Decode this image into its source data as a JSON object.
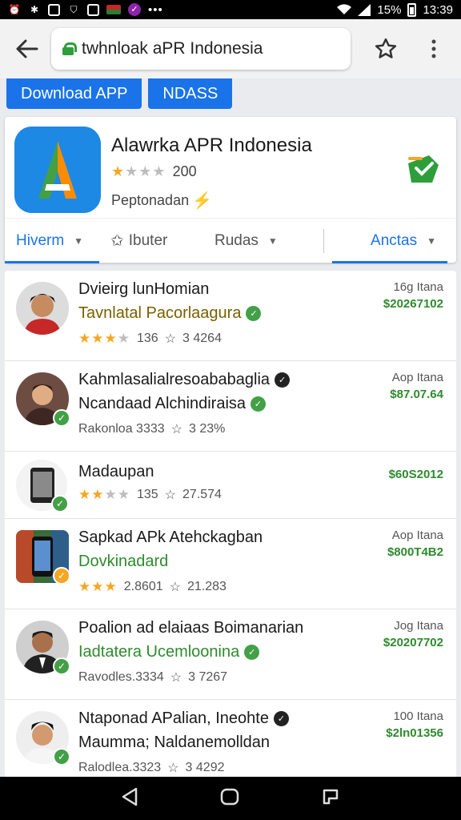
{
  "status_bar": {
    "battery": "15%",
    "time": "13:39",
    "notification_icons": [
      "alarm-icon",
      "bluetooth-icon",
      "gallery-icon",
      "shield-icon",
      "camera-icon",
      "flag-icon",
      "viber-icon"
    ],
    "more": "•••"
  },
  "browser": {
    "url": "twhnloak aPR Indonesia"
  },
  "actions": {
    "download_label": "Download APP",
    "secondary_label": "NDASS"
  },
  "app": {
    "name": "Alawrka APR Indonesia",
    "rating_count": "200",
    "rating": 1,
    "subtitle": "Peptonadan"
  },
  "tabs": [
    {
      "label": "Hiverm"
    },
    {
      "label": "Ibuter"
    },
    {
      "label": "Rudas"
    },
    {
      "label": "Anctas"
    }
  ],
  "list": [
    {
      "title": "Dvieirg lunHomian",
      "subtitle": "Tavnlatal Pacorlaagura",
      "rating": 3,
      "count": "136",
      "extra": "3 4264",
      "right_label": "16g Itana",
      "price": "$20267102"
    },
    {
      "title": "Kahmlasalialresoababaglia",
      "subtitle": "Ncandaad Alchindiraisa",
      "rating": 0,
      "count": "Rakonloa 3333",
      "extra": "3 23%",
      "right_label": "Aop Itana",
      "price": "$87.07.64"
    },
    {
      "title": "Madaupan",
      "subtitle": "",
      "rating": 2,
      "count": "135",
      "extra": "27.574",
      "right_label": "",
      "price": "$60S2012"
    },
    {
      "title": "Sapkad APk Atehckagban",
      "subtitle": "Dovkinadard",
      "rating": 3,
      "count": "2.8601",
      "extra": "21.283",
      "right_label": "Aop Itana",
      "price": "$800T4B2"
    },
    {
      "title": "Poalion ad elaiaas Boimanarian",
      "subtitle": "Iadtatera Ucemloonina",
      "rating": 0,
      "count": "Ravodles.3334",
      "extra": "3 7267",
      "right_label": "Jog Itana",
      "price": "$20207702"
    },
    {
      "title": "Ntaponad APalian, Ineohte",
      "subtitle": "Maumma; Naldanemolldan",
      "rating": 0,
      "count": "Ralodlea.3323",
      "extra": "3 4292",
      "right_label": "100 Itana",
      "price": "$2ln01356"
    }
  ],
  "colors": {
    "accent": "#1a73e8",
    "green": "#2e8b2e",
    "star": "#f5a623"
  }
}
